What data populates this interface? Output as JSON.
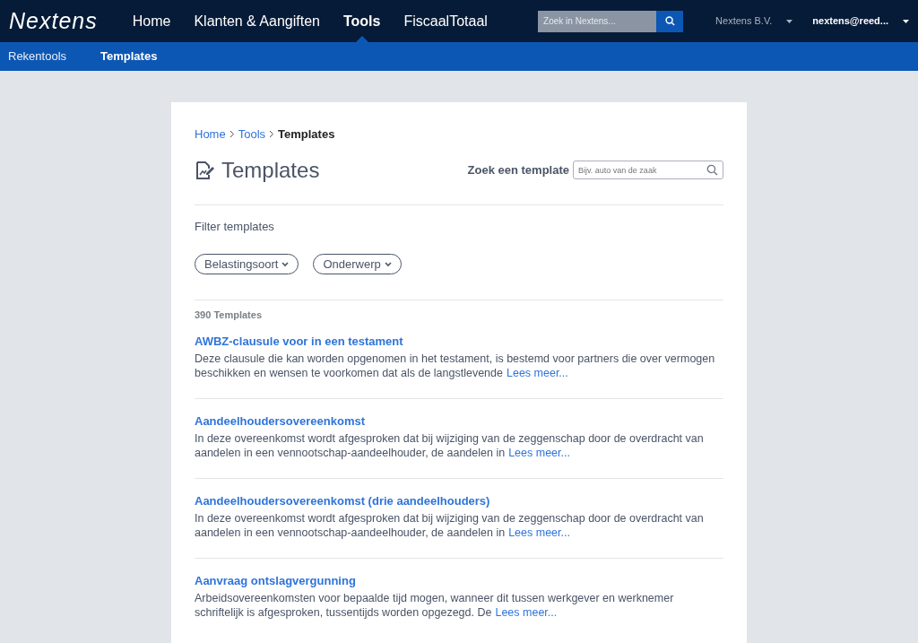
{
  "navbar": {
    "logo": "Nextens",
    "items": [
      {
        "label": "Home",
        "selected": false
      },
      {
        "label": "Klanten & Aangiften",
        "selected": false
      },
      {
        "label": "Tools",
        "selected": true
      },
      {
        "label": "FiscaalTotaal",
        "selected": false
      }
    ],
    "search": {
      "placeholder": "Zoek in Nextens..."
    },
    "company": "Nextens B.V.",
    "user": "nextens@reed..."
  },
  "subnav": [
    {
      "label": "Rekentools",
      "selected": false
    },
    {
      "label": "Templates",
      "selected": true
    }
  ],
  "breadcrumb": [
    "Home",
    "Tools",
    "Templates"
  ],
  "title": "Templates",
  "search": {
    "label": "Zoek een template",
    "placeholder": "Bijv. auto van de zaak"
  },
  "filter": {
    "label": "Filter templates",
    "dropdowns": [
      "Belastingsoort",
      "Onderwerp"
    ]
  },
  "count": "390 Templates",
  "templates": [
    {
      "title": "AWBZ-clausule voor in een testament",
      "description": "Deze clausule die kan worden opgenomen in het testament, is bestemd voor partners die over vermogen beschikken en wensen te voorkomen dat als de langstlevende",
      "more": "Lees meer..."
    },
    {
      "title": "Aandeelhoudersovereenkomst",
      "description": "In deze overeenkomst wordt afgesproken dat bij wijziging van de zeggenschap door de overdracht van aandelen in een vennootschap-aandeelhouder, de aandelen in",
      "more": "Lees meer..."
    },
    {
      "title": "Aandeelhoudersovereenkomst (drie aandeelhouders)",
      "description": "In deze overeenkomst wordt afgesproken dat bij wijziging van de zeggenschap door de overdracht van aandelen in een vennootschap-aandeelhouder, de aandelen in",
      "more": "Lees meer..."
    },
    {
      "title": "Aanvraag ontslagvergunning",
      "description": "Arbeidsovereenkomsten voor bepaalde tijd mogen, wanneer dit tussen werkgever en werknemer schriftelijk is afgesproken, tussentijds worden opgezegd. De",
      "more": "Lees meer..."
    }
  ]
}
